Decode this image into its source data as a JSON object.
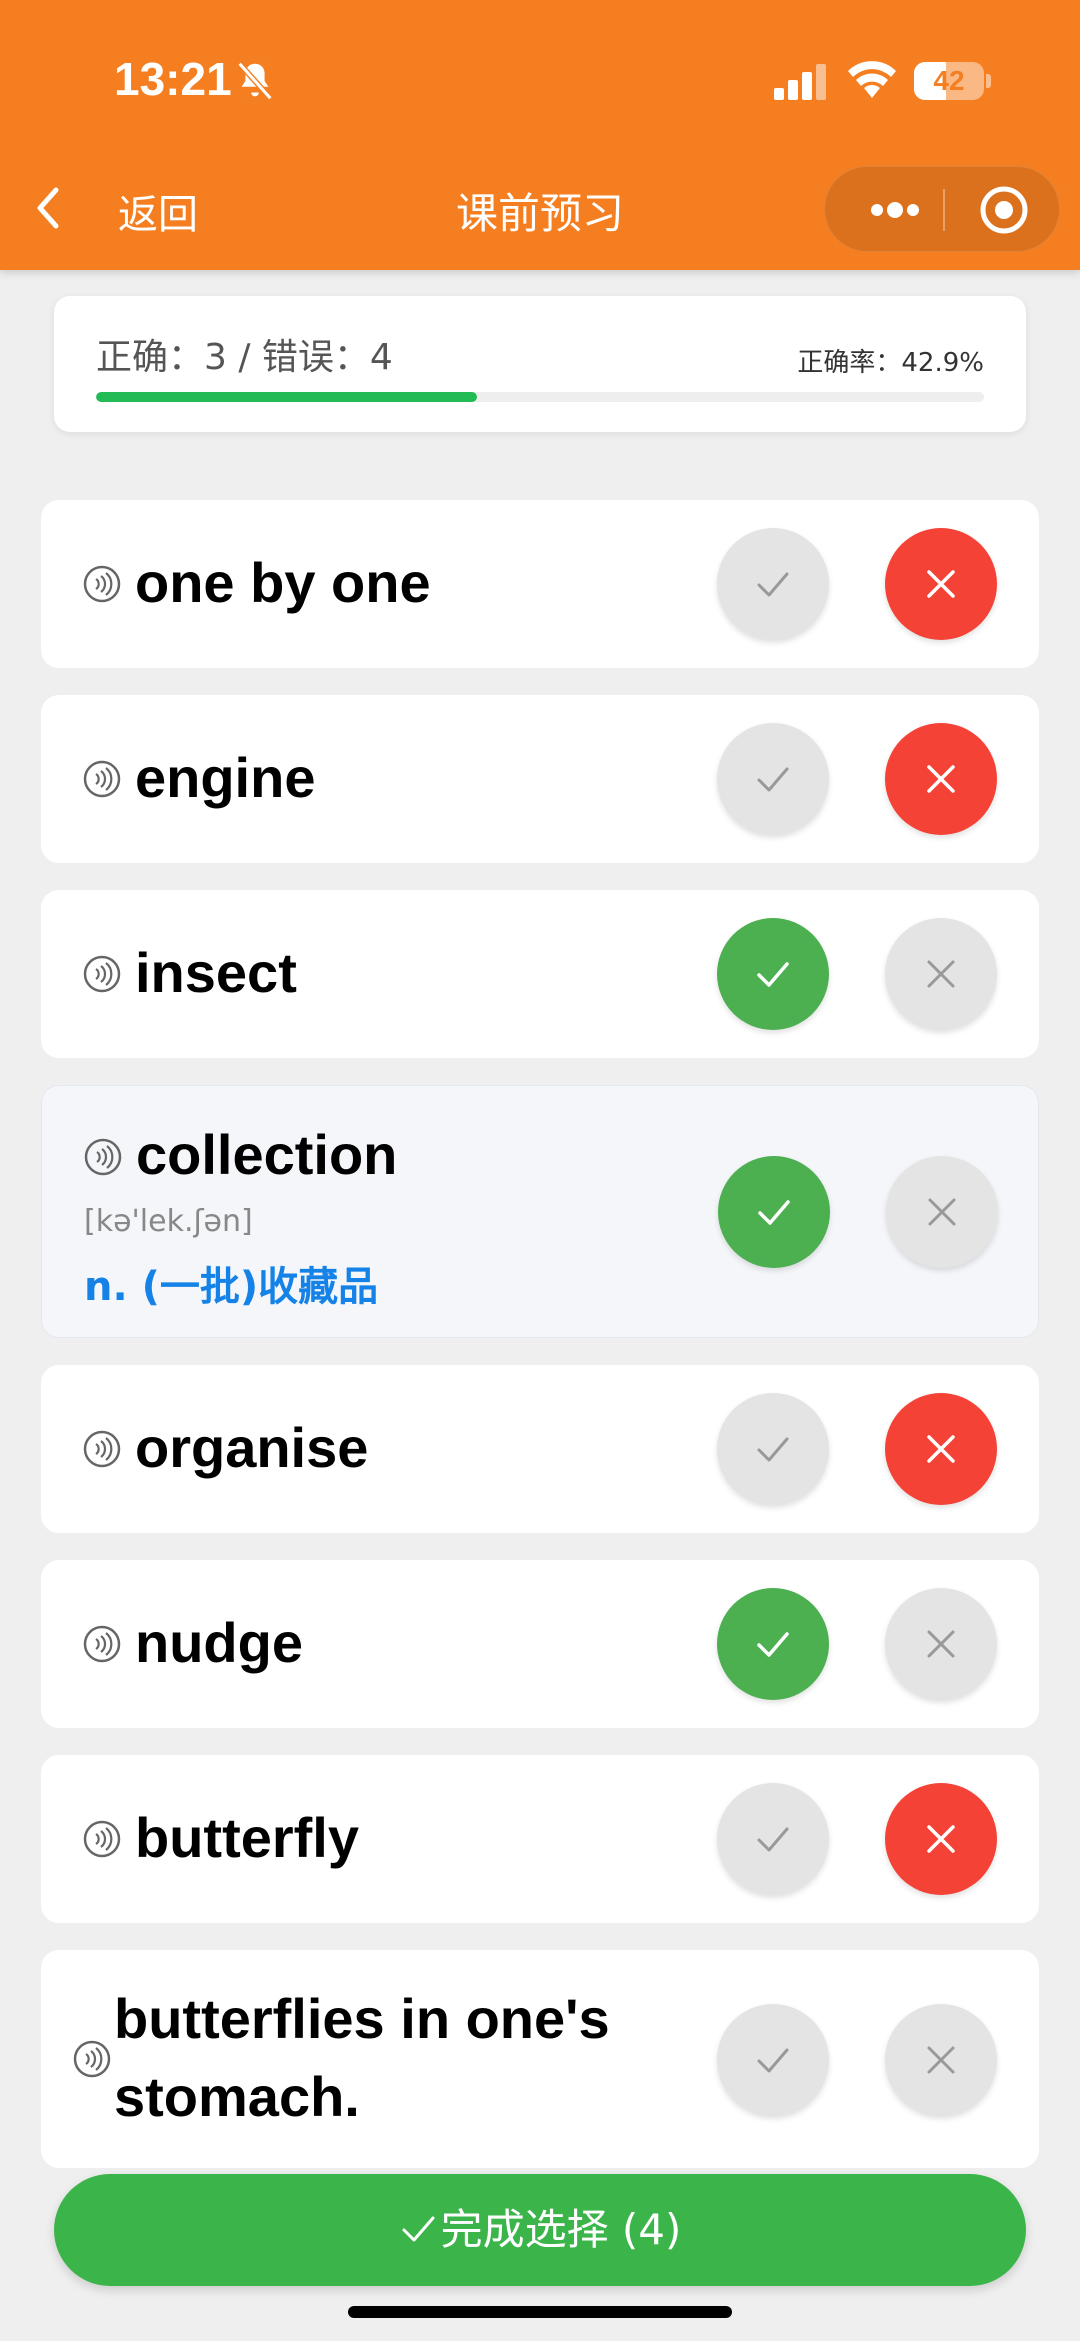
{
  "status_bar": {
    "time": "13:21",
    "battery": "42"
  },
  "nav": {
    "back_label": "返回",
    "title": "课前预习"
  },
  "stats": {
    "summary": "正确：3 / 错误：4",
    "accuracy": "正确率：42.9%",
    "progress": 0.429
  },
  "words": [
    {
      "word": "one by one",
      "status": "wrong"
    },
    {
      "word": "engine",
      "status": "wrong"
    },
    {
      "word": "insect",
      "status": "correct"
    },
    {
      "word": "collection",
      "status": "correct",
      "phonetic": "[kə'lek.ʃən]",
      "meaning": "n. (一批)收藏品"
    },
    {
      "word": "organise",
      "status": "wrong"
    },
    {
      "word": "nudge",
      "status": "correct"
    },
    {
      "word": "butterfly",
      "status": "wrong"
    },
    {
      "word": "butterflies in one's stomach.",
      "status": "none"
    }
  ],
  "complete_button": {
    "label": "完成选择 (4)"
  },
  "colors": {
    "header": "#f47e20",
    "correct": "#4caf50",
    "wrong": "#f44336",
    "meaning": "#1482e6",
    "complete": "#3bb54a"
  }
}
